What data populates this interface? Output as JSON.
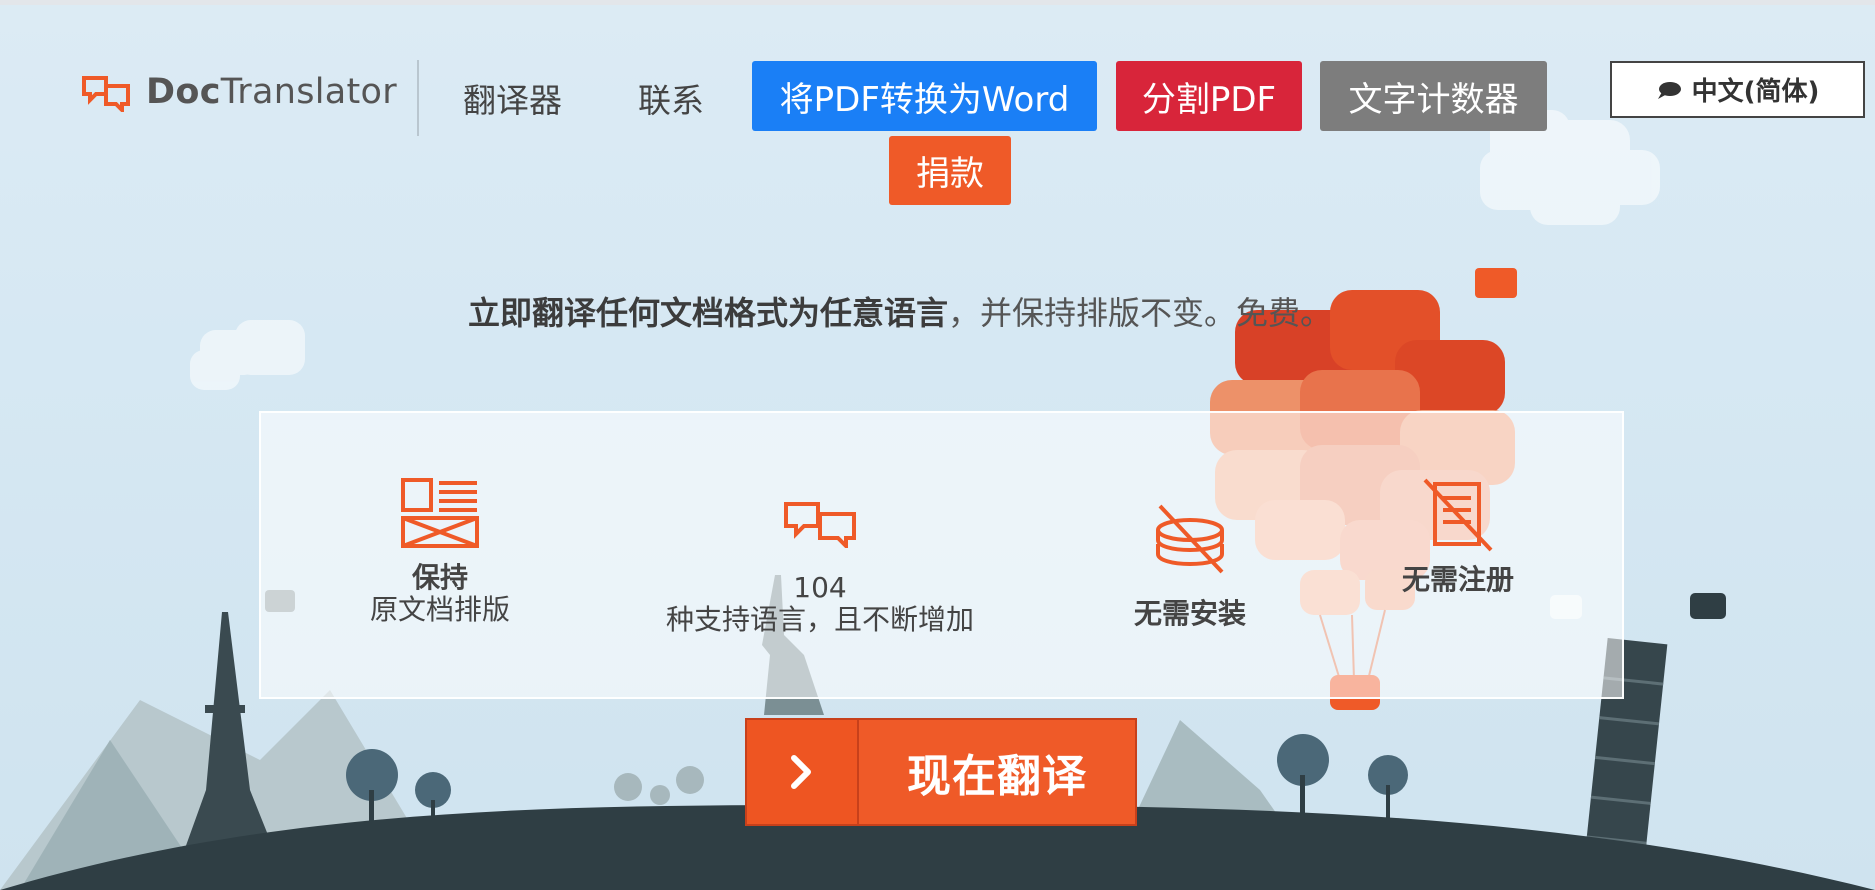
{
  "header": {
    "logo_bold": "Doc",
    "logo_rest": "Translator",
    "nav": [
      "翻译器",
      "联系"
    ],
    "buttons": {
      "pdf_to_word": "将PDF转换为Word",
      "split_pdf": "分割PDF",
      "word_counter": "文字计数器",
      "donate": "捐款"
    },
    "language": "中文(简体)"
  },
  "tagline": {
    "bold": "立即翻译任何文档格式为任意语言",
    "rest": "，并保持排版不变。免费。"
  },
  "features": [
    {
      "title": "保持",
      "subtitle": "原文档排版",
      "icon": "layout-icon"
    },
    {
      "title": "104",
      "subtitle": "种支持语言，且不断增加",
      "icon": "translate-bubbles-icon"
    },
    {
      "title": "无需安装",
      "subtitle": "",
      "icon": "no-install-icon"
    },
    {
      "title": "无需注册",
      "subtitle": "",
      "icon": "no-registration-icon"
    }
  ],
  "cta": {
    "label": "现在翻译",
    "icon": "chevron-right-icon"
  },
  "colors": {
    "accent": "#ef5a28",
    "blue": "#1a7ff6",
    "red": "#d8253a",
    "gray": "#7d7d7d",
    "background": "#d6e8f3",
    "ground": "#2f3e44"
  }
}
